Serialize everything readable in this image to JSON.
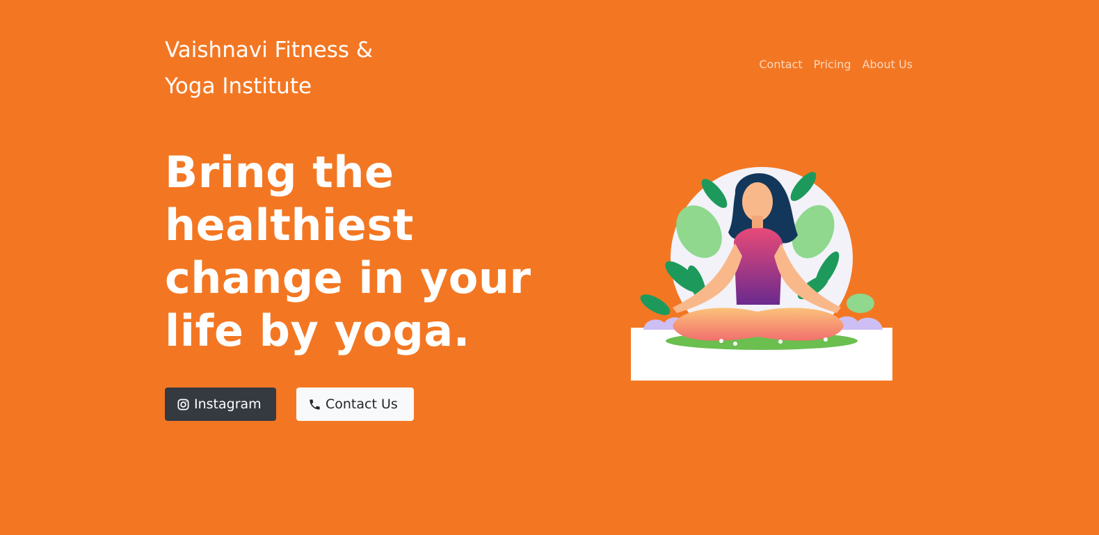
{
  "header": {
    "brand": "Vaishnavi Fitness & Yoga Institute",
    "nav": [
      "Contact",
      "Pricing",
      "About Us"
    ]
  },
  "hero": {
    "headline": "Bring the healthiest change in your life by yoga.",
    "buttons": [
      {
        "label": "Instagram",
        "icon": "instagram-icon"
      },
      {
        "label": "Contact Us",
        "icon": "phone-icon"
      }
    ],
    "illustration": "woman-meditating-yoga-illustration"
  },
  "colors": {
    "background": "#f37723",
    "dark_button": "#343a40",
    "light_button": "#f8f9fa",
    "nav_link": "#fbd8bf"
  }
}
